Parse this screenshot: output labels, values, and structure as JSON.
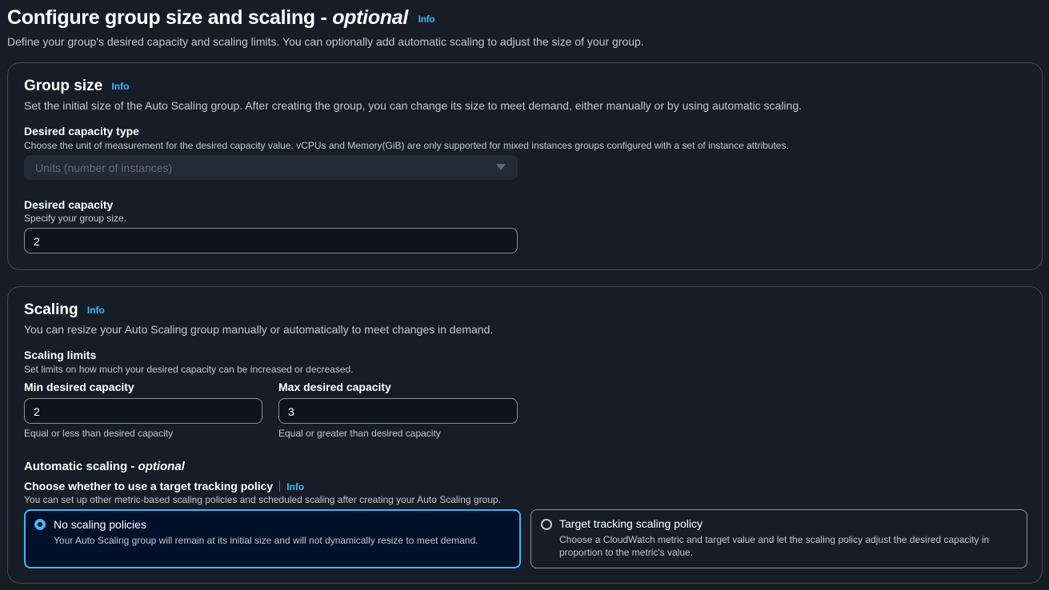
{
  "header": {
    "title": "Configure group size and scaling - ",
    "title_optional": "optional",
    "info": "Info",
    "description": "Define your group's desired capacity and scaling limits. You can optionally add automatic scaling to adjust the size of your group."
  },
  "group_size": {
    "title": "Group size",
    "info": "Info",
    "description": "Set the initial size of the Auto Scaling group. After creating the group, you can change its size to meet demand, either manually or by using automatic scaling.",
    "capacity_type": {
      "label": "Desired capacity type",
      "description": "Choose the unit of measurement for the desired capacity value. vCPUs and Memory(GiB) are only supported for mixed instances groups configured with a set of instance attributes.",
      "value": "Units (number of instances)"
    },
    "desired_capacity": {
      "label": "Desired capacity",
      "description": "Specify your group size.",
      "value": "2"
    }
  },
  "scaling": {
    "title": "Scaling",
    "info": "Info",
    "description": "You can resize your Auto Scaling group manually or automatically to meet changes in demand.",
    "limits": {
      "label": "Scaling limits",
      "description": "Set limits on how much your desired capacity can be increased or decreased."
    },
    "min": {
      "label": "Min desired capacity",
      "value": "2",
      "hint": "Equal or less than desired capacity"
    },
    "max": {
      "label": "Max desired capacity",
      "value": "3",
      "hint": "Equal or greater than desired capacity"
    },
    "automatic": {
      "title": "Automatic scaling - ",
      "title_optional": "optional",
      "question": "Choose whether to use a target tracking policy",
      "info": "Info",
      "description": "You can set up other metric-based scaling policies and scheduled scaling after creating your Auto Scaling group.",
      "options": [
        {
          "label": "No scaling policies",
          "description": "Your Auto Scaling group will remain at its initial size and will not dynamically resize to meet demand.",
          "selected": true
        },
        {
          "label": "Target tracking scaling policy",
          "description": "Choose a CloudWatch metric and target value and let the scaling policy adjust the desired capacity in proportion to the metric's value.",
          "selected": false
        }
      ]
    }
  }
}
